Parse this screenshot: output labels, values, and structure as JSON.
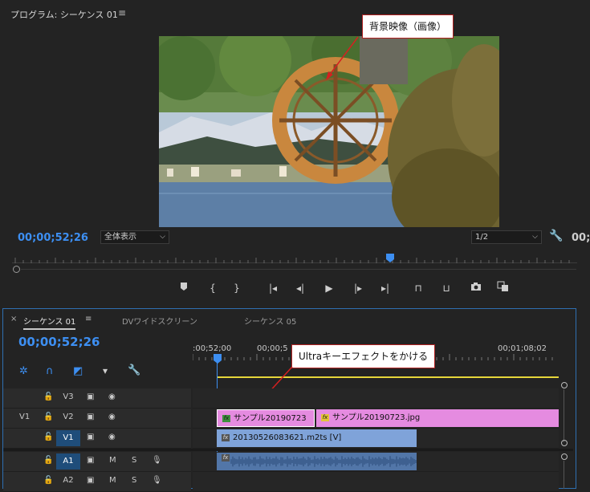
{
  "program_monitor": {
    "title": "プログラム: シーケンス 01",
    "menu_icon": "hamburger-icon",
    "timecode": "00;00;52;26",
    "zoom_dropdown": "全体表示",
    "resolution_dropdown": "1/2",
    "duration": "00;0",
    "callout_background": "背景映像（画像）",
    "transport_icons": [
      "marker-icon",
      "in-point-icon",
      "out-point-icon",
      "go-to-in-icon",
      "step-back-icon",
      "play-icon",
      "step-forward-icon",
      "go-to-out-icon",
      "lift-icon",
      "extract-icon",
      "camera-icon",
      "compare-icon"
    ]
  },
  "timeline": {
    "tabs": [
      "シーケンス 01",
      "DVワイドスクリーン",
      "シーケンス 05"
    ],
    "close_label": "×",
    "timecode": "00;00;52;26",
    "ruler_labels": [
      ":00;52;00",
      "00;00;5",
      "00;01;08;02"
    ],
    "callout_effect": "Ultraキーエフェクトをかける",
    "tracks": [
      {
        "name": "V3",
        "toggle": ""
      },
      {
        "name": "V2",
        "toggle": "V1"
      },
      {
        "name": "V1",
        "toggle": ""
      },
      {
        "name": "A1",
        "toggle": "",
        "m": "M",
        "s": "S"
      },
      {
        "name": "A2",
        "toggle": "",
        "m": "M",
        "s": "S"
      }
    ],
    "clips": {
      "v2_clip1": "サンプル20190723",
      "v2_clip2": "サンプル20190723.jpg",
      "v1_clip": "20130526083621.m2ts [V]"
    },
    "fx_label": "fx"
  },
  "colors": {
    "accent": "#3d8ff2",
    "v2_clip": "#e58be0",
    "v1_clip": "#7fa3d9",
    "audio_clip": "#5276a8",
    "work_area": "#e6d63a",
    "panel_border": "#2f6fb1"
  }
}
